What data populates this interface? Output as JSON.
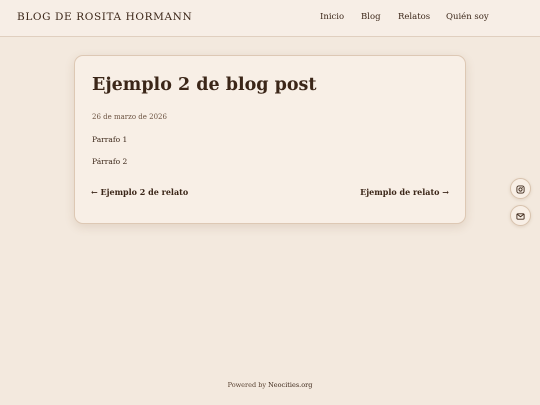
{
  "header": {
    "site_title": "BLOG DE ROSITA HORMANN",
    "nav": [
      "Inicio",
      "Blog",
      "Relatos",
      "Quién soy"
    ]
  },
  "post": {
    "title": "Ejemplo 2 de blog post",
    "date": "26 de marzo de 2026",
    "paragraphs": [
      "Parrafo 1",
      "Párrafo 2"
    ],
    "prev_link": "← Ejemplo 2 de relato",
    "next_link": "Ejemplo de relato →"
  },
  "social": {
    "icons": [
      "instagram-icon",
      "mail-icon"
    ]
  },
  "footer": {
    "prefix": "Powered by ",
    "link": "Neocities.org"
  },
  "colors": {
    "background": "#f3e9de",
    "card": "#f8efe6",
    "text": "#3b2618"
  }
}
